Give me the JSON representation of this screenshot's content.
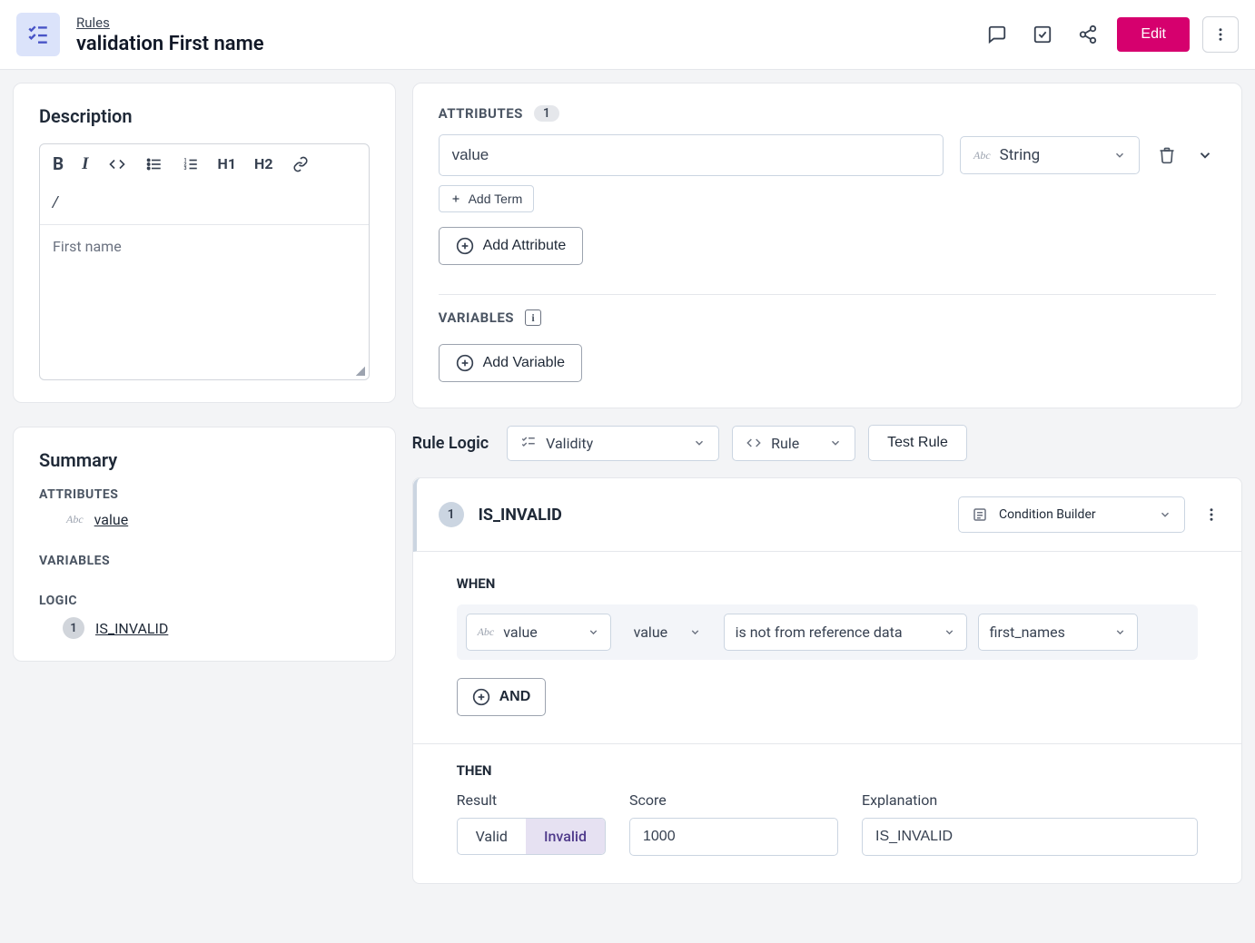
{
  "header": {
    "breadcrumb": "Rules",
    "title": "validation First name",
    "edit_label": "Edit"
  },
  "description": {
    "title": "Description",
    "content": "First name",
    "tools": {
      "bold": "B",
      "italic": "I",
      "h1": "H1",
      "h2": "H2",
      "slash": "/"
    }
  },
  "summary": {
    "title": "Summary",
    "sections": {
      "attributes_label": "ATTRIBUTES",
      "attribute_value": "value",
      "variables_label": "VARIABLES",
      "logic_label": "LOGIC",
      "logic_item_badge": "1",
      "logic_item": "IS_INVALID"
    }
  },
  "attributes": {
    "label": "ATTRIBUTES",
    "count": "1",
    "value_input": "value",
    "type_select": "String",
    "add_term": "Add Term",
    "add_attribute": "Add Attribute"
  },
  "variables": {
    "label": "VARIABLES",
    "add_variable": "Add Variable"
  },
  "rule_logic": {
    "title": "Rule Logic",
    "validity_select": "Validity",
    "rule_select": "Rule",
    "test_rule": "Test Rule"
  },
  "rule": {
    "badge": "1",
    "name": "IS_INVALID",
    "condition_builder": "Condition Builder",
    "when_label": "WHEN",
    "when": {
      "field1": "value",
      "field2": "value",
      "op": "is not from reference data",
      "ref": "first_names"
    },
    "and_label": "AND",
    "then_label": "THEN",
    "then": {
      "result_label": "Result",
      "valid": "Valid",
      "invalid": "Invalid",
      "score_label": "Score",
      "score_value": "1000",
      "explanation_label": "Explanation",
      "explanation_value": "IS_INVALID"
    }
  }
}
